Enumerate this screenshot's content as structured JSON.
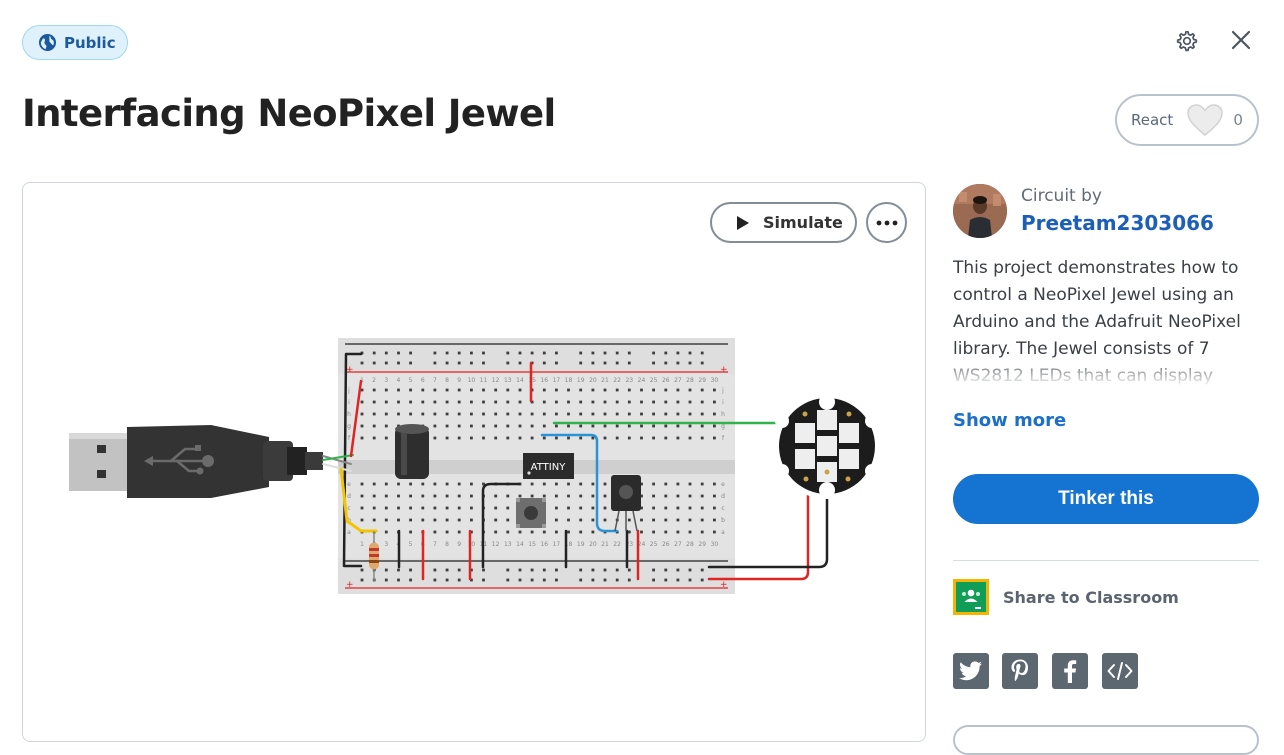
{
  "header": {
    "visibility_label": "Public",
    "title": "Interfacing NeoPixel Jewel",
    "react_label": "React",
    "react_count": "0",
    "icons": [
      "globe-icon",
      "gear-icon",
      "close-icon",
      "heart-icon"
    ]
  },
  "viewer": {
    "simulate_label": "Simulate",
    "chip_label": "ATTINY",
    "icons": [
      "play-icon",
      "ellipsis-icon"
    ],
    "breadboard_column_numbers": [
      "1",
      "2",
      "3",
      "4",
      "5",
      "6",
      "7",
      "8",
      "9",
      "10",
      "11",
      "12",
      "13",
      "14",
      "15",
      "16",
      "17",
      "18",
      "19",
      "20",
      "21",
      "22",
      "23",
      "24",
      "25",
      "26",
      "27",
      "28",
      "29",
      "30"
    ],
    "breadboard_row_letters_top": [
      "j",
      "i",
      "h",
      "g",
      "f"
    ],
    "breadboard_row_letters_bottom": [
      "e",
      "d",
      "c",
      "b",
      "a"
    ]
  },
  "sidebar": {
    "byline": "Circuit by",
    "author": "Preetam2303066",
    "description": "This project demonstrates how to control a NeoPixel Jewel using an Arduino and the Adafruit NeoPixel library. The Jewel consists of 7 WS2812 LEDs that can display",
    "show_more": "Show more",
    "tinker_button": "Tinker this",
    "share_classroom": "Share to Classroom",
    "social_icons": [
      "twitter-icon",
      "pinterest-icon",
      "facebook-icon",
      "embed-icon"
    ]
  },
  "colors": {
    "accent": "#1573d1",
    "link": "#1d5fb8",
    "badge_bg": "#dff2fb",
    "wire_red": "#e02424",
    "wire_green": "#2fb34a",
    "wire_blue": "#2a93d5",
    "wire_yellow": "#f2c500"
  }
}
